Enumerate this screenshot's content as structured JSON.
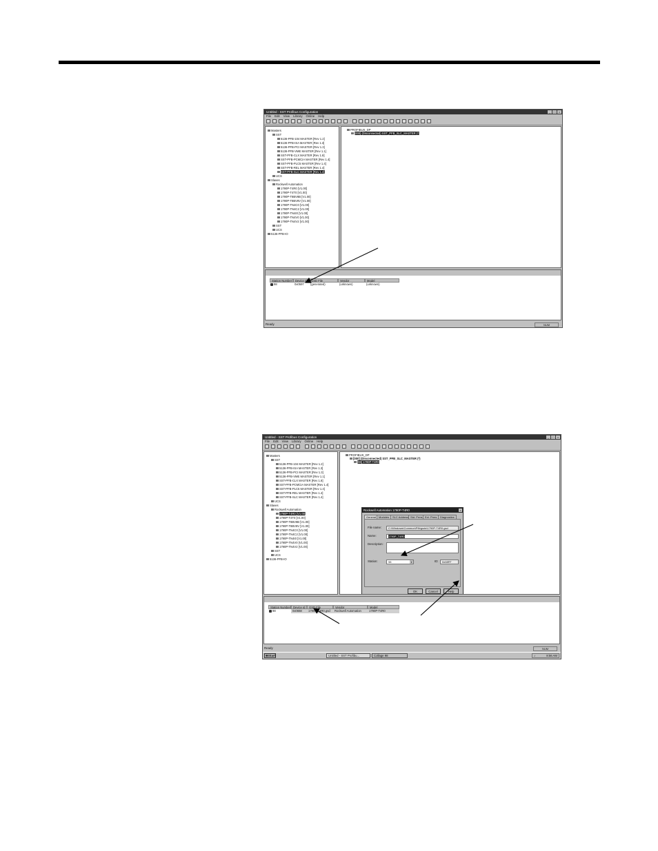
{
  "screenshot1": {
    "title": "Untitled - SST Profibus Configuration",
    "menu": [
      "File",
      "Edit",
      "View",
      "Library",
      "Online",
      "Help"
    ],
    "right_root": "PROFIBUS_DP",
    "right_master": "[000] (Disconnected) SST_PFB_SLC_MASTER (*)",
    "tree": [
      {
        "text": "Masters",
        "level": 0
      },
      {
        "text": "SST",
        "level": 1
      },
      {
        "text": "5136-PFB-104 MASTER [Rev 1.2]",
        "level": 2
      },
      {
        "text": "5136-PFB-ISA MASTER [Rev 1.3]",
        "level": 2
      },
      {
        "text": "5136-PFB-PCI MASTER [Rev 1.3]",
        "level": 2
      },
      {
        "text": "5136-PFB-VME MASTER [Rev 1.1]",
        "level": 2
      },
      {
        "text": "SST-PFB-CLX MASTER [Rev 1.8]",
        "level": 2
      },
      {
        "text": "SST-PFB-PCMCIA MASTER [Rev 1.4]",
        "level": 2
      },
      {
        "text": "SST-PFB-PLC5 MASTER [Rev 1.4]",
        "level": 2
      },
      {
        "text": "SST-PFB-REL MASTER [Rev 1.4]",
        "level": 2
      },
      {
        "text": "SST-PFB-SLC MASTER [Rev 1.4]",
        "level": 2,
        "selected": true
      },
      {
        "text": "UCS",
        "level": 1
      },
      {
        "text": "Slaves",
        "level": 0
      },
      {
        "text": "Rockwell Automation",
        "level": 1
      },
      {
        "text": "1790P-T4R0 [V1.00]",
        "level": 2
      },
      {
        "text": "1790P-T4T0 [V1.00]",
        "level": 2
      },
      {
        "text": "1790P-T8BV8B [V1.00]",
        "level": 2
      },
      {
        "text": "1790P-T8BV8V [V1.00]",
        "level": 2
      },
      {
        "text": "1790P-TN4C0 [V1.00]",
        "level": 2
      },
      {
        "text": "1790P-TN4C2 [V1.00]",
        "level": 2
      },
      {
        "text": "1790P-TN4I0 [V1.00]",
        "level": 2
      },
      {
        "text": "1790P-TN4V0 [V1.00]",
        "level": 2
      },
      {
        "text": "1790P-TN4V2 [V1.00]",
        "level": 2
      },
      {
        "text": "SST",
        "level": 1
      },
      {
        "text": "UCS",
        "level": 1
      },
      {
        "text": "5136-PFB-IO",
        "level": 0
      }
    ],
    "columns": [
      "Station Number",
      "Device Id",
      "GSD File",
      "Vendor",
      "Model"
    ],
    "row": [
      "98",
      "0x0597",
      "(generated)",
      "(unknown)",
      "(unknown)"
    ],
    "status": "Ready",
    "status_right": "NUM"
  },
  "screenshot2": {
    "title": "Untitled - SST Profibus Configuration",
    "menu": [
      "File",
      "Edit",
      "View",
      "Library",
      "Online",
      "Help"
    ],
    "right_root": "PROFIBUS_DP",
    "right_master": "[000] (Disconnected) SST_PFB_SLC_MASTER (*)",
    "right_slave": "[98] 1790P-T4R0",
    "tree": [
      {
        "text": "Masters",
        "level": 0
      },
      {
        "text": "SST",
        "level": 1
      },
      {
        "text": "5136-PFB-104 MASTER [Rev 1.2]",
        "level": 2
      },
      {
        "text": "5136-PFB-ISA MASTER [Rev 1.3]",
        "level": 2
      },
      {
        "text": "5136-PFB-PCI MASTER [Rev 1.3]",
        "level": 2
      },
      {
        "text": "5136-PFB-VME MASTER [Rev 1.1]",
        "level": 2
      },
      {
        "text": "SST-PFB-CLX MASTER [Rev 1.8]",
        "level": 2
      },
      {
        "text": "SST-PFB-PCMCIA MASTER [Rev 1.4]",
        "level": 2
      },
      {
        "text": "SST-PFB-PLC5 MASTER [Rev 1.4]",
        "level": 2
      },
      {
        "text": "SST-PFB-REL MASTER [Rev 1.4]",
        "level": 2
      },
      {
        "text": "SST-PFB-SLC MASTER [Rev 1.4]",
        "level": 2
      },
      {
        "text": "UCS",
        "level": 1
      },
      {
        "text": "Slaves",
        "level": 0
      },
      {
        "text": "Rockwell Automation",
        "level": 1
      },
      {
        "text": "1790P-T4R0 [V1.00]",
        "level": 2,
        "selected": true
      },
      {
        "text": "1790P-T4T0 [V1.00]",
        "level": 2
      },
      {
        "text": "1790P-T8BV8B [V1.00]",
        "level": 2
      },
      {
        "text": "1790P-T8BV8V [V1.00]",
        "level": 2
      },
      {
        "text": "1790P-TN4C0 [V1.00]",
        "level": 2
      },
      {
        "text": "1790P-TN4C2 [V1.00]",
        "level": 2
      },
      {
        "text": "1790P-TN4I0 [V1.00]",
        "level": 2
      },
      {
        "text": "1790P-TN4V0 [V1.00]",
        "level": 2
      },
      {
        "text": "1790P-TN4V2 [V1.00]",
        "level": 2
      },
      {
        "text": "SST",
        "level": 1
      },
      {
        "text": "UCS",
        "level": 1
      },
      {
        "text": "5136-PFB-IO",
        "level": 0
      }
    ],
    "dialog": {
      "title": "Rockwell Automation 1790P-T4R0",
      "tabs": [
        "General",
        "Modules",
        "SLC Address",
        "Std. Prms",
        "Ext. Prms",
        "Diagnostics"
      ],
      "file_label": "File name:",
      "file_value": "C:\\Windows\\Common\\Pfb\\gsds\\1790P-T4R0.gsd",
      "name_label": "Name:",
      "name_value": "1790P_T4R0",
      "desc_label": "Description:",
      "station_label": "Station:",
      "station_value": "98",
      "id_label": "ID:",
      "id_value": "0x08FF",
      "ok": "OK",
      "cancel": "Cancel",
      "help": "Help"
    },
    "columns": [
      "Station Number",
      "Device Id",
      "GSD File",
      "Vendor",
      "Model"
    ],
    "row": [
      "98",
      "0x0668",
      "1790P-T4R0.gsd",
      "Rockwell Automation",
      "1790P-T4R0"
    ],
    "status": "Ready",
    "status_right": "NUM",
    "taskbar": {
      "start": "Start",
      "items": [
        "Untitled - SST Profibu...",
        "Collage 98"
      ],
      "clock": "8:56 AM"
    }
  }
}
